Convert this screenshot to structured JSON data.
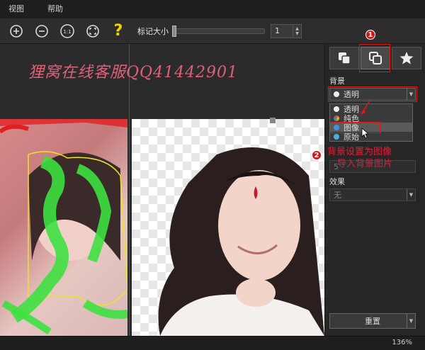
{
  "menu": {
    "items": [
      "视图",
      "帮助"
    ]
  },
  "toolbar": {
    "zoom_in_icon": "zoom-in-icon",
    "zoom_out_icon": "zoom-out-icon",
    "actual_size_label": "1:1",
    "fit_icon": "fit-screen-icon",
    "help_glyph": "?",
    "marker_size_label": "标记大小",
    "marker_size_value": "1"
  },
  "canvas": {
    "watermark": "狸窝在线客服QQ41442901"
  },
  "panel": {
    "tabs": [
      "copy-layers-icon",
      "duplicate-icon",
      "star-icon"
    ],
    "background_label": "背景",
    "background_selected": "透明",
    "background_options": [
      {
        "label": "透明",
        "color": "#eeeeee"
      },
      {
        "label": "纯色",
        "color": "#e04030"
      },
      {
        "label": "图像",
        "color": "#4a90d9"
      },
      {
        "label": "原始",
        "color": "#4ab0e0"
      }
    ],
    "blur_value": "5",
    "effect_label": "效果",
    "effect_value": "无",
    "reset_label": "重置"
  },
  "annotations": {
    "circle1": "1",
    "circle2": "2",
    "note_line1": "背景设置为图像",
    "note_line2": "导入背景图片"
  },
  "status": {
    "zoom": "136%"
  },
  "colors": {
    "accent_red": "#e01818",
    "help_yellow": "#f5d000",
    "watermark": "#e0607a"
  }
}
